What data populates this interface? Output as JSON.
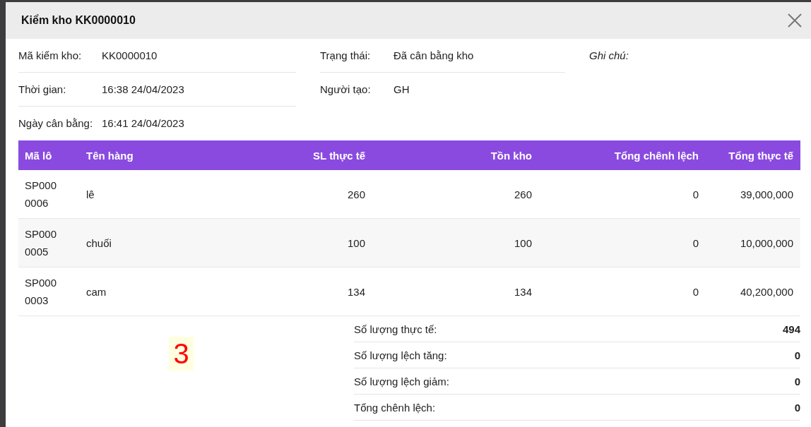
{
  "dialog": {
    "title": "Kiểm kho KK0000010"
  },
  "info_columns": [
    [
      {
        "label": "Mã kiểm kho:",
        "value": "KK0000010"
      },
      {
        "label": "Thời gian:",
        "value": "16:38 24/04/2023"
      },
      {
        "label": "Ngày cân bằng:",
        "value": "16:41 24/04/2023"
      }
    ],
    [
      {
        "label": "Trạng thái:",
        "value": "Đã cân bằng kho"
      },
      {
        "label": "Người tạo:",
        "value": "GH"
      }
    ],
    [
      {
        "label": "Ghi chú:"
      }
    ]
  ],
  "table": {
    "columns": [
      {
        "label": "Mã lô",
        "kind": "text"
      },
      {
        "label": "Tên hàng",
        "kind": "text"
      },
      {
        "label": "SL thực tế",
        "kind": "number"
      },
      {
        "label": "Tồn kho",
        "kind": "number"
      },
      {
        "label": "Tổng chênh lệch",
        "kind": "number"
      },
      {
        "label": "Tổng thực tế",
        "kind": "number"
      }
    ],
    "rows": [
      [
        "SP0000006",
        "lê",
        "260",
        "260",
        "0",
        "39,000,000"
      ],
      [
        "SP0000005",
        "chuối",
        "100",
        "100",
        "0",
        "10,000,000"
      ],
      [
        "SP0000003",
        "cam",
        "134",
        "134",
        "0",
        "40,200,000"
      ]
    ]
  },
  "marker": "3",
  "summary": [
    {
      "label": "Số lượng thực tế:",
      "value": "494"
    },
    {
      "label": "Số lượng lệch tăng:",
      "value": "0"
    },
    {
      "label": "Số lượng lệch giảm:",
      "value": "0"
    },
    {
      "label": "Tổng chênh lệch:",
      "value": "0"
    }
  ]
}
